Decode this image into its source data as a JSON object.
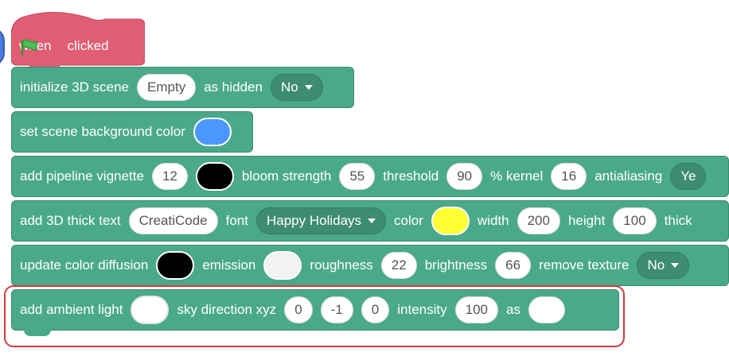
{
  "hat": {
    "when": "when",
    "clicked": "clicked",
    "flag_icon": "green-flag-icon"
  },
  "blocks": {
    "init": {
      "label": "initialize 3D scene",
      "scene_value": "Empty",
      "as_hidden": "as hidden",
      "hidden_value": "No"
    },
    "bg": {
      "label": "set scene background color",
      "color": "#4c97ff"
    },
    "vignette": {
      "label": "add pipeline vignette",
      "vignette_value": "12",
      "vignette_color": "#000000",
      "bloom_label": "bloom strength",
      "bloom_value": "55",
      "threshold_label": "threshold",
      "threshold_value": "90",
      "kernel_label": "% kernel",
      "kernel_value": "16",
      "aa_label": "antialiasing",
      "aa_value": "Ye"
    },
    "text3d": {
      "label": "add 3D thick text",
      "text_value": "CreatiCode",
      "font_label": "font",
      "font_value": "Happy Holidays",
      "color_label": "color",
      "color": "#ffff33",
      "width_label": "width",
      "width_value": "200",
      "height_label": "height",
      "height_value": "100",
      "thick_label": "thick"
    },
    "diffusion": {
      "label": "update color diffusion",
      "diffusion_color": "#000000",
      "emission_label": "emission",
      "emission_color": "#f2f2f2",
      "roughness_label": "roughness",
      "roughness_value": "22",
      "brightness_label": "brightness",
      "brightness_value": "66",
      "remove_label": "remove texture",
      "remove_value": "No"
    },
    "ambient": {
      "label": "add ambient light",
      "light_color": "#ffffff",
      "sky_label": "sky direction xyz",
      "x": "0",
      "y": "-1",
      "z": "0",
      "intensity_label": "intensity",
      "intensity_value": "100",
      "as_label": "as",
      "as_value": ""
    }
  },
  "colors": {
    "hat": "#e05d73",
    "block": "#4aa98b",
    "highlight": "#d33a3a"
  }
}
